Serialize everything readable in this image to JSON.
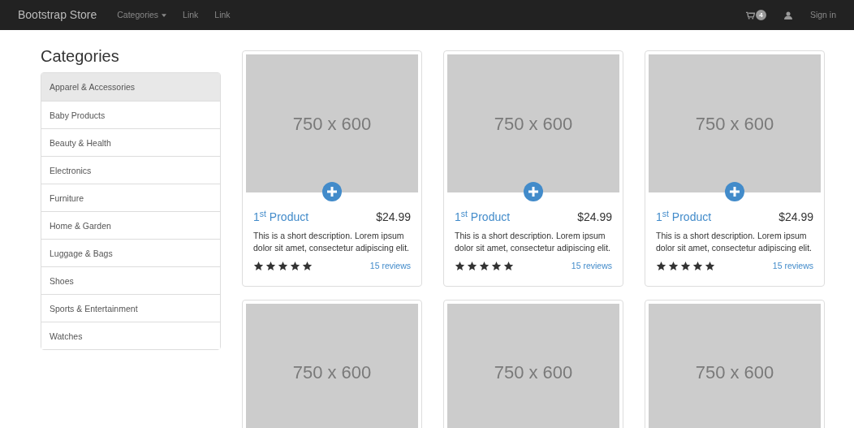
{
  "navbar": {
    "brand": "Bootstrap Store",
    "links": [
      {
        "label": "Categories",
        "dropdown": true
      },
      {
        "label": "Link",
        "dropdown": false
      },
      {
        "label": "Link",
        "dropdown": false
      }
    ],
    "cart_count": "4",
    "sign_in": "Sign in"
  },
  "sidebar": {
    "title": "Categories",
    "items": [
      {
        "label": "Apparel & Accessories",
        "selected": true
      },
      {
        "label": "Baby Products",
        "selected": false
      },
      {
        "label": "Beauty & Health",
        "selected": false
      },
      {
        "label": "Electronics",
        "selected": false
      },
      {
        "label": "Furniture",
        "selected": false
      },
      {
        "label": "Home & Garden",
        "selected": false
      },
      {
        "label": "Luggage & Bags",
        "selected": false
      },
      {
        "label": "Shoes",
        "selected": false
      },
      {
        "label": "Sports & Entertainment",
        "selected": false
      },
      {
        "label": "Watches",
        "selected": false
      }
    ]
  },
  "products": [
    {
      "image_label": "750 x 600",
      "name": "1$^{st}$ Product",
      "price": "$24.99",
      "description": "This is a short description. Lorem ipsum dolor sit amet, consectetur adipiscing elit.",
      "stars": 5,
      "reviews": "15 reviews"
    },
    {
      "image_label": "750 x 600",
      "name": "1$^{st}$ Product",
      "price": "$24.99",
      "description": "This is a short description. Lorem ipsum dolor sit amet, consectetur adipiscing elit.",
      "stars": 5,
      "reviews": "15 reviews"
    },
    {
      "image_label": "750 x 600",
      "name": "1$^{st}$ Product",
      "price": "$24.99",
      "description": "This is a short description. Lorem ipsum dolor sit amet, consectetur adipiscing elit.",
      "stars": 5,
      "reviews": "15 reviews"
    },
    {
      "image_label": "750 x 600"
    },
    {
      "image_label": "750 x 600"
    },
    {
      "image_label": "750 x 600"
    }
  ]
}
